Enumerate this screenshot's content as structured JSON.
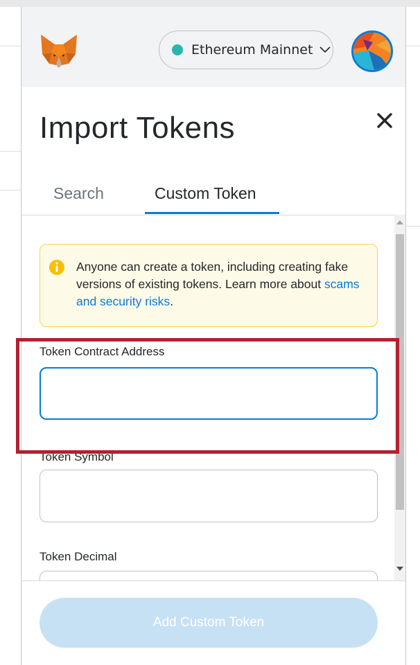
{
  "header": {
    "network_label": "Ethereum Mainnet"
  },
  "page": {
    "title": "Import Tokens"
  },
  "tabs": [
    {
      "label": "Search",
      "active": false
    },
    {
      "label": "Custom Token",
      "active": true
    }
  ],
  "warning": {
    "text": "Anyone can create a token, including creating fake versions of existing tokens. Learn more about ",
    "link_text": "scams and security risks",
    "suffix": "."
  },
  "fields": {
    "contract_address": {
      "label": "Token Contract Address",
      "value": ""
    },
    "symbol": {
      "label": "Token Symbol",
      "value": ""
    },
    "decimal": {
      "label": "Token Decimal",
      "value": ""
    }
  },
  "footer": {
    "add_button_label": "Add Custom Token"
  },
  "colors": {
    "accent": "#037dd6",
    "network_dot": "#29b6af",
    "warning_bg": "#fefae8",
    "warning_border": "#ffd33d",
    "highlight": "#b3202f",
    "button_disabled": "#c7e1f4"
  },
  "icons": {
    "logo": "metamask-fox-icon",
    "network_dropdown": "chevron-down-icon",
    "close": "close-icon",
    "warning": "info-icon"
  }
}
